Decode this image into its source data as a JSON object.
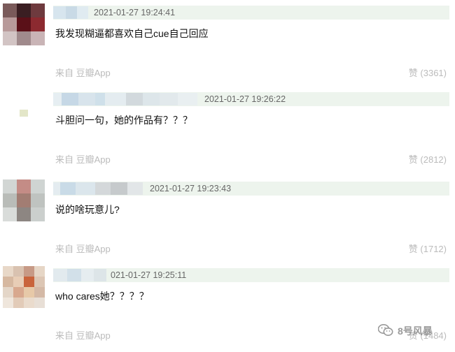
{
  "comments": [
    {
      "timestamp": "2021-01-27 19:24:41",
      "text": "我发现糊逼都喜欢自己cue自己回应",
      "source": "来自 豆瓣App",
      "likes": "赞 (3361)"
    },
    {
      "timestamp": "2021-01-27 19:26:22",
      "text": "斗胆问一句，她的作品有？？？",
      "source": "来自 豆瓣App",
      "likes": "赞 (2812)"
    },
    {
      "timestamp": "2021-01-27 19:23:43",
      "text": "说的啥玩意儿?",
      "source": "来自 豆瓣App",
      "likes": "赞 (1712)"
    },
    {
      "timestamp": "021-01-27 19:25:11",
      "text": "who cares她？？？？",
      "source": "来自 豆瓣App",
      "likes": "赞 (1484)"
    }
  ],
  "watermark": {
    "text": "8号风暴",
    "icon": "wechat-icon"
  },
  "colors": {
    "header_bg": "#edf4ed",
    "meta_text": "#bbbbbb",
    "body_text": "#111111"
  }
}
